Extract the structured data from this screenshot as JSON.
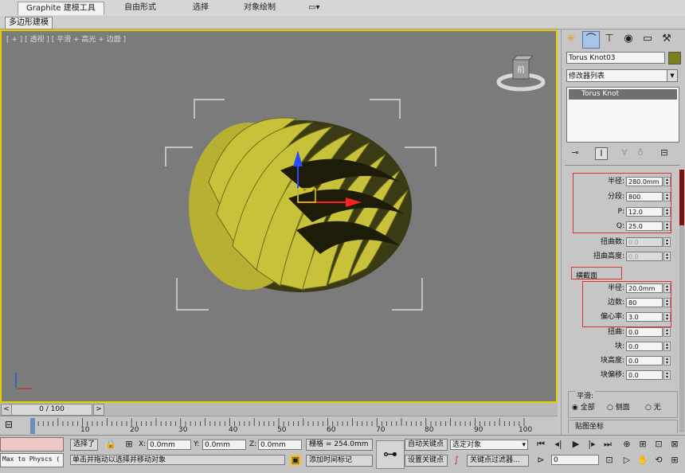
{
  "ribbon": {
    "tabs": [
      {
        "label": "Graphite 建模工具",
        "active": true
      },
      {
        "label": "自由形式"
      },
      {
        "label": "选择"
      },
      {
        "label": "对象绘制"
      }
    ],
    "subtab": "多边形建模"
  },
  "viewport": {
    "label": "[ + ] [ 透视 ] [ 平滑 + 高光 + 边面 ]",
    "viewcube_face": "前",
    "border_color": "#e4d000",
    "object_color": "#c8c23a"
  },
  "timeline": {
    "frame": "0 / 100",
    "prev": "<",
    "next": ">",
    "ticks": [
      "10",
      "20",
      "30",
      "40",
      "50",
      "60",
      "70",
      "80",
      "90",
      "100"
    ]
  },
  "status": {
    "script_field": "Max to Physcs (",
    "selection": "选择了",
    "x_label": "X:",
    "x_value": "0.0mm",
    "y_label": "Y:",
    "y_value": "0.0mm",
    "z_label": "Z:",
    "z_value": "0.0mm",
    "grid": "栅格 = 254.0mm",
    "prompt": "单击并拖动以选择并移动对象",
    "add_time_tag": "添加时间标记",
    "auto_key": "自动关键点",
    "set_key": "设置关键点",
    "key_mode": "选定对象",
    "key_filters": "关键点过滤器...",
    "frame_value": "0"
  },
  "command_panel": {
    "object_name": "Torus Knot03",
    "object_color": "#7f7f1a",
    "modifier_list": "修改器列表",
    "stack_item": "Torus Knot",
    "base_curve": [
      {
        "label": "半径:",
        "value": "280.0mm"
      },
      {
        "label": "分段:",
        "value": "800"
      },
      {
        "label": "P:",
        "value": "12.0"
      },
      {
        "label": "Q:",
        "value": "25.0"
      },
      {
        "label": "扭曲数:",
        "value": "0.0",
        "disabled": true
      },
      {
        "label": "扭曲高度:",
        "value": "0.0",
        "disabled": true
      }
    ],
    "cross_section_title": "横截面",
    "cross_section": [
      {
        "label": "半径:",
        "value": "20.0mm"
      },
      {
        "label": "边数:",
        "value": "80"
      },
      {
        "label": "偏心率:",
        "value": "3.0"
      },
      {
        "label": "扭曲:",
        "value": "0.0"
      },
      {
        "label": "块:",
        "value": "0.0"
      },
      {
        "label": "块高度:",
        "value": "0.0"
      },
      {
        "label": "块偏移:",
        "value": "0.0"
      }
    ],
    "smooth_title": "平滑:",
    "smooth_options": [
      "全部",
      "侧面",
      "无"
    ],
    "smooth_selected": "全部",
    "mapping_title": "贴图坐标"
  }
}
